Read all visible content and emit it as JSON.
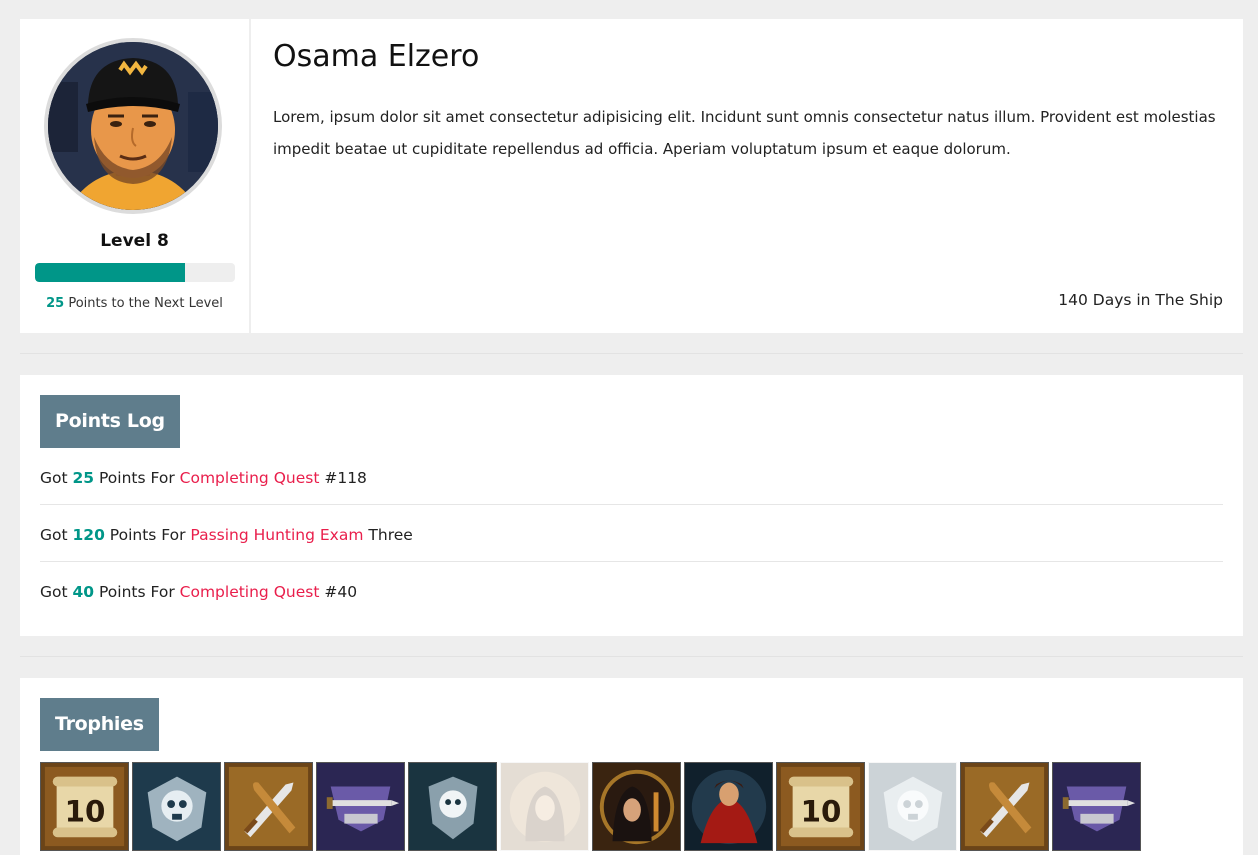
{
  "profile": {
    "name": "Osama Elzero",
    "bio": "Lorem, ipsum dolor sit amet consectetur adipisicing elit. Incidunt sunt omnis consectetur natus illum. Provident est molestias impedit beatae ut cupiditate repellendus ad officia. Aperiam voluptatum ipsum et eaque dolorum.",
    "level": "Level 8",
    "progress_fraction": 0.75,
    "points_to_next": "25",
    "points_to_next_label": " Points to the Next Level",
    "days": "140 Days in The Ship",
    "avatar_icon": "user-avatar-photo"
  },
  "points_log": {
    "title": "Points Log",
    "entries": [
      {
        "prefix": "Got ",
        "points": "25",
        "mid": " Points For ",
        "link": "Completing Quest",
        "suffix": " #118"
      },
      {
        "prefix": "Got ",
        "points": "120",
        "mid": " Points For ",
        "link": "Passing Hunting Exam",
        "suffix": " Three"
      },
      {
        "prefix": "Got ",
        "points": "40",
        "mid": " Points For ",
        "link": "Completing Quest",
        "suffix": " #40"
      }
    ]
  },
  "trophies": {
    "title": "Trophies",
    "items": [
      {
        "icon": "scroll-10-trophy-icon",
        "faded": false
      },
      {
        "icon": "skull-shield-trophy-icon",
        "faded": false
      },
      {
        "icon": "crossed-sword-club-trophy-icon",
        "faded": false
      },
      {
        "icon": "sword-anvil-trophy-icon",
        "faded": false
      },
      {
        "icon": "skull-crest-trophy-icon",
        "faded": false
      },
      {
        "icon": "hooded-figure-trophy-icon",
        "faded": true
      },
      {
        "icon": "hooded-woman-trophy-icon",
        "faded": false
      },
      {
        "icon": "red-cloak-trophy-icon",
        "faded": false
      },
      {
        "icon": "scroll-10-trophy-icon",
        "faded": false
      },
      {
        "icon": "skull-shield-trophy-icon",
        "faded": true
      },
      {
        "icon": "crossed-sword-club-trophy-icon",
        "faded": false
      },
      {
        "icon": "sword-anvil-trophy-icon",
        "faded": false
      }
    ]
  },
  "colors": {
    "accent": "#009688",
    "link": "#e91e4b",
    "panel_title_bg": "#5f7d8c",
    "page_bg": "#eeeeee"
  }
}
